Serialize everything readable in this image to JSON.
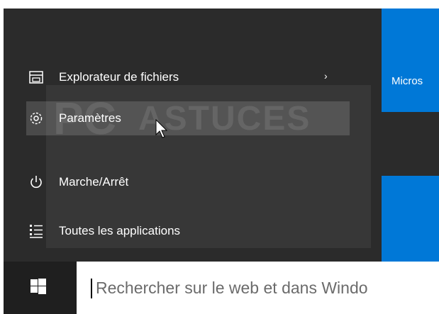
{
  "start_menu": {
    "items": [
      {
        "label": "Explorateur de fichiers",
        "icon": "file-explorer-icon",
        "has_submenu": true
      },
      {
        "label": "Paramètres",
        "icon": "settings-gear-icon",
        "hovered": true
      },
      {
        "label": "Marche/Arrêt",
        "icon": "power-icon"
      },
      {
        "label": "Toutes les applications",
        "icon": "all-apps-list-icon"
      }
    ],
    "submenu_chevron": "›"
  },
  "tiles": {
    "top_tile_label": "Micros"
  },
  "taskbar": {
    "start_icon": "windows-logo-icon",
    "search_placeholder": "Rechercher sur le web et dans Windo"
  },
  "watermark": {
    "part1": "PC",
    "part2": "ASTUCES"
  },
  "colors": {
    "menu_bg": "#2b2b2b",
    "hover_bg": "#4a4a4a",
    "tile_blue": "#0078d7",
    "taskbar_bg": "#1f1f1f"
  }
}
